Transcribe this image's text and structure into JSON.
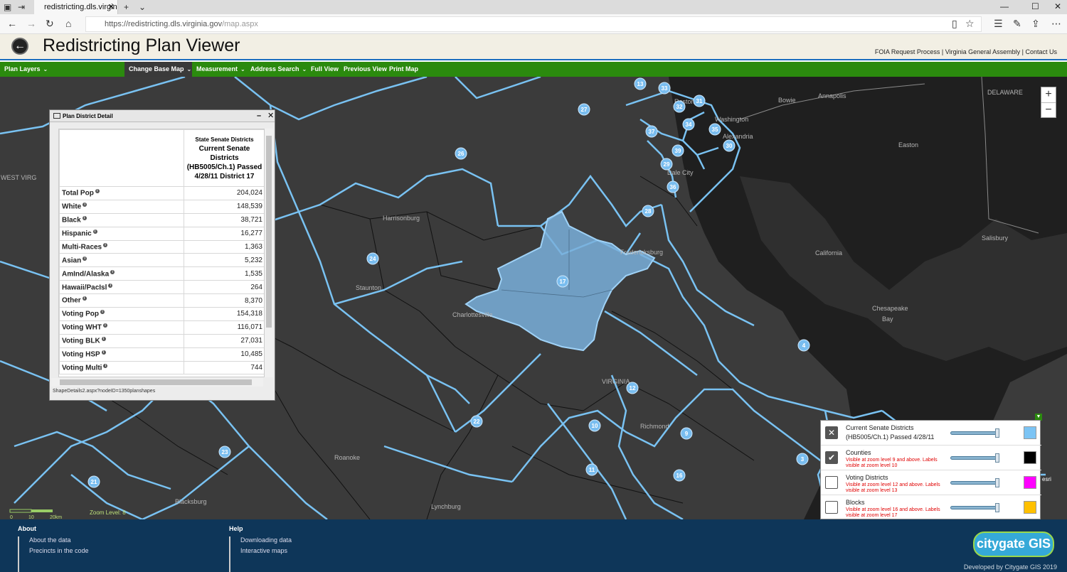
{
  "browser": {
    "tab_title": "redistricting.dls.virginia.",
    "url_host": "https://redistricting.dls.virginia.gov",
    "url_path": "/map.aspx"
  },
  "app": {
    "title": "Redistricting Plan Viewer",
    "links": "FOIA Request Process | Virginia General Assembly | Contact Us"
  },
  "menu": {
    "plan_layers": "Plan Layers",
    "change_base_map": "Change Base Map",
    "measurement": "Measurement",
    "address_search": "Address Search",
    "full_view": "Full View",
    "previous_view": "Previous View",
    "print_map": "Print Map"
  },
  "map": {
    "places": [
      "Annapolis",
      "Washington",
      "Alexandria",
      "Reston",
      "Bowie",
      "Easton",
      "Harrisonburg",
      "Staunton",
      "Charlottesville",
      "Fredericksburg",
      "California",
      "Salisbury",
      "Chesapeake",
      "Bay",
      "VIRGINIA",
      "Richmond",
      "Lynchburg",
      "Roanoke",
      "Blacksburg",
      "WEST VIRG",
      "DELAWARE",
      "Dale City"
    ],
    "district_labels": [
      "13",
      "33",
      "27",
      "31",
      "32",
      "34",
      "35",
      "37",
      "39",
      "30",
      "26",
      "29",
      "36",
      "28",
      "24",
      "17",
      "4",
      "12",
      "22",
      "10",
      "9",
      "23",
      "3",
      "11",
      "16",
      "21"
    ],
    "scale": {
      "start": "0",
      "mid": "10",
      "end": "20km"
    },
    "zoom_level_text": "Zoom Level: 8",
    "zoom_in": "+",
    "zoom_out": "−",
    "attribution": "esri"
  },
  "panel": {
    "title": "Plan District Detail",
    "col_subtitle": "State Senate Districts",
    "col_title": "Current Senate Districts (HB5005/Ch.1) Passed 4/28/11 District 17",
    "rows": [
      {
        "label": "Total Pop",
        "value": "204,024"
      },
      {
        "label": "White",
        "value": "148,539"
      },
      {
        "label": "Black",
        "value": "38,721"
      },
      {
        "label": "Hispanic",
        "value": "16,277"
      },
      {
        "label": "Multi-Races",
        "value": "1,363"
      },
      {
        "label": "Asian",
        "value": "5,232"
      },
      {
        "label": "AmInd/Alaska",
        "value": "1,535"
      },
      {
        "label": "Hawaii/PacIsl",
        "value": "264"
      },
      {
        "label": "Other",
        "value": "8,370"
      },
      {
        "label": "Voting Pop",
        "value": "154,318"
      },
      {
        "label": "Voting WHT",
        "value": "116,071"
      },
      {
        "label": "Voting BLK",
        "value": "27,031"
      },
      {
        "label": "Voting HSP",
        "value": "10,485"
      },
      {
        "label": "Voting Multi",
        "value": "744"
      }
    ],
    "status": "ShapeDetails2.aspx?nodeID=1350planshapes"
  },
  "legend": {
    "rows": [
      {
        "name": "Current Senate Districts (HB5005/Ch.1) Passed 4/28/11",
        "note": "",
        "color": "#7cc4f4",
        "state": "remove"
      },
      {
        "name": "Counties",
        "note": "Visible at zoom level 9 and above. Labels visible at zoom level 10",
        "color": "#000000",
        "state": "checked"
      },
      {
        "name": "Voting Districts",
        "note": "Visible at zoom level 12 and above. Labels visible at zoom level 13",
        "color": "#ff00ff",
        "state": "unchecked"
      },
      {
        "name": "Blocks",
        "note": "Visible at zoom level 16 and above. Labels visible at zoom level 17",
        "color": "#ffc000",
        "state": "unchecked"
      }
    ]
  },
  "footer": {
    "about_heading": "About",
    "about_links": [
      "About the data",
      "Precincts in the code"
    ],
    "help_heading": "Help",
    "help_links": [
      "Downloading data",
      "Interactive maps"
    ],
    "logo_text": "citygate GIS",
    "developed_by": "Developed by Citygate GIS 2019"
  }
}
